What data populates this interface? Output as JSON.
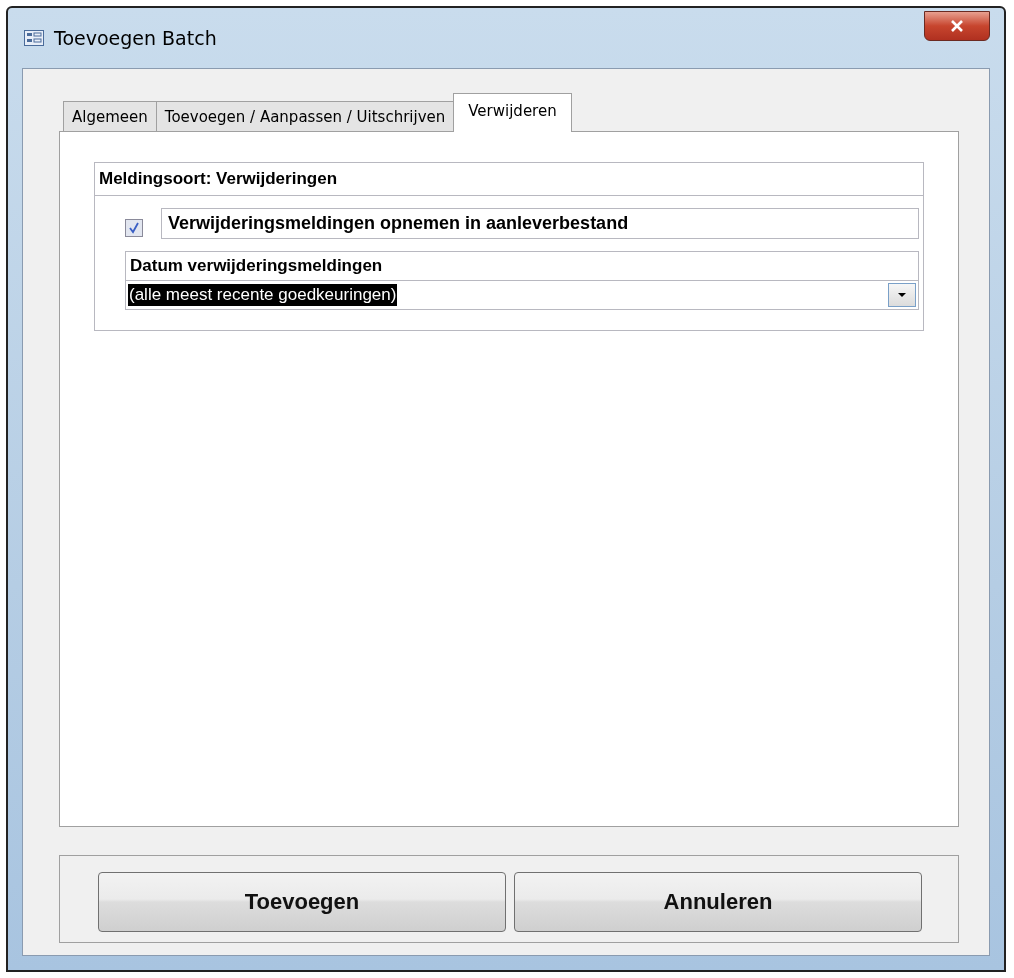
{
  "window": {
    "title": "Toevoegen Batch"
  },
  "tabs": [
    {
      "label": "Algemeen",
      "selected": false
    },
    {
      "label": "Toevoegen / Aanpassen / Uitschrijven",
      "selected": false
    },
    {
      "label": "Verwijderen",
      "selected": true
    }
  ],
  "group": {
    "title": "Meldingsoort: Verwijderingen",
    "checkbox": {
      "label": "Verwijderingsmeldingen opnemen in aanleverbestand",
      "checked": true
    },
    "dropdown": {
      "label": "Datum verwijderingsmeldingen",
      "value": "(alle meest recente goedkeuringen)",
      "highlighted": true
    }
  },
  "buttons": [
    "Toevoegen",
    "Annuleren"
  ]
}
